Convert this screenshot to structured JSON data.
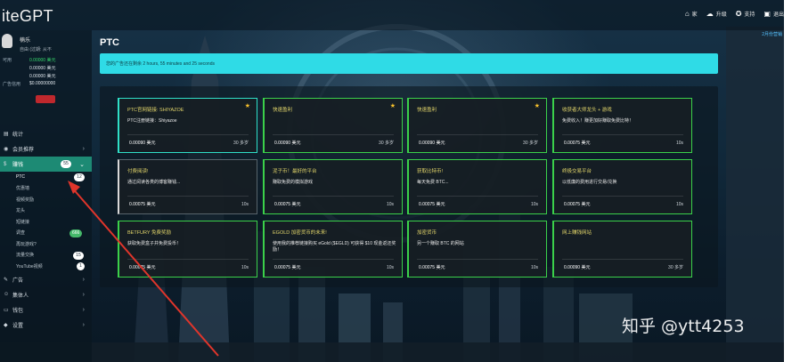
{
  "app": {
    "logo_text": "iteGPT"
  },
  "topnav": [
    {
      "icon": "home-icon",
      "glyph": "⌂",
      "label": "家"
    },
    {
      "icon": "cloud-upload-icon",
      "glyph": "☁",
      "label": "升级"
    },
    {
      "icon": "support-icon",
      "glyph": "✪",
      "label": "支持"
    },
    {
      "icon": "logout-icon",
      "glyph": "▣",
      "label": "退出"
    }
  ],
  "corner_link": "2月份营销",
  "user": {
    "name": "楠乐",
    "membership": "自由 (过期:  从不"
  },
  "balances": [
    {
      "key": "可用",
      "value": "0.00000 美元",
      "highlight": true
    },
    {
      "key": "",
      "value": "0.00000 美元",
      "highlight": false
    },
    {
      "key": "",
      "value": "0.00000 美元",
      "highlight": false
    },
    {
      "key": "广告信用",
      "value": "$0.00000000",
      "highlight": false
    }
  ],
  "sidebar_menu": [
    {
      "icon": "chart-icon",
      "glyph": "▤",
      "label": "统计"
    },
    {
      "icon": "users-icon",
      "glyph": "◉",
      "label": "会员推荐"
    },
    {
      "icon": "dollar-icon",
      "glyph": "$",
      "label": "赚钱",
      "badge": "55",
      "active": true
    }
  ],
  "earn_submenu": [
    {
      "label": "PTC",
      "badge": "12",
      "badge_color": "white",
      "selected": true
    },
    {
      "label": "优惠墙"
    },
    {
      "label": "视频奖励"
    },
    {
      "label": "龙头"
    },
    {
      "label": "短链接"
    },
    {
      "label": "调查",
      "badge": "666",
      "badge_color": "green"
    },
    {
      "label": "再玩游戏?"
    },
    {
      "label": "流量交换",
      "badge": "15",
      "badge_color": "white"
    },
    {
      "label": "YouTube视频",
      "badge": "1",
      "badge_color": "white"
    }
  ],
  "sidebar_menu_bottom": [
    {
      "icon": "megaphone-icon",
      "glyph": "✎",
      "label": "广告"
    },
    {
      "icon": "user-icon",
      "glyph": "☺",
      "label": "集体人"
    },
    {
      "icon": "wallet-icon",
      "glyph": "▭",
      "label": "钱包"
    },
    {
      "icon": "lock-icon",
      "glyph": "◆",
      "label": "设置"
    }
  ],
  "main": {
    "title": "PTC",
    "banner_text": "您的广告还在剩余 2 hours, 55 minutes and 25 seconds"
  },
  "ads": [
    {
      "title": "PTC官网链接:  SHIYAZOE",
      "desc": "PTC注册链接：Shiyazoe",
      "reward": "0.00090 美元",
      "time": "30 多岁",
      "star": true,
      "border": "teal"
    },
    {
      "title": "快速盈利",
      "desc": "",
      "reward": "0.00090 美元",
      "time": "30 多岁",
      "star": true,
      "border": "green"
    },
    {
      "title": "快速盈利",
      "desc": "",
      "reward": "0.00090 美元",
      "time": "30 多岁",
      "star": true,
      "border": "green"
    },
    {
      "title": "收获者大师龙头 + 游戏",
      "desc": "免费收入！赚更加好赚取免费比特！",
      "reward": "0.00075 美元",
      "time": "10s",
      "star": false,
      "border": "green"
    },
    {
      "title": "付费阅读!",
      "desc": "通过阅读各类的博客赚钱...",
      "reward": "0.00075 美元",
      "time": "10s",
      "star": false,
      "border": "plain"
    },
    {
      "title": "泥子币！最好的平台",
      "desc": "赚取免费的模拟游戏",
      "reward": "0.00075 美元",
      "time": "10s",
      "star": false,
      "border": "green"
    },
    {
      "title": "获取比特币!",
      "desc": "每天免费 BTC...",
      "reward": "0.00075 美元",
      "time": "10s",
      "star": false,
      "border": "green"
    },
    {
      "title": "终极交易平台",
      "desc": "以低廉的费用进行交易/兑换",
      "reward": "0.00075 美元",
      "time": "10s",
      "star": false,
      "border": "green"
    },
    {
      "title": "BETFURY 免费奖励",
      "desc": "获取免费盒子并免费投币！",
      "reward": "0.00075 美元",
      "time": "10s",
      "star": false,
      "border": "green"
    },
    {
      "title": "EGOLD 加密货币的未来!",
      "desc": "使用我的推荐链接购买 eGold ($EGLD) 可获得 $10 现金返还奖励！",
      "reward": "0.00075 美元",
      "time": "10s",
      "star": false,
      "border": "green"
    },
    {
      "title": "加密货币",
      "desc": "另一个赚取 BTC 的网站",
      "reward": "0.00075 美元",
      "time": "10s",
      "star": false,
      "border": "green"
    },
    {
      "title": "网上赚钱网站",
      "desc": "",
      "reward": "0.00090 美元",
      "time": "30 多岁",
      "star": false,
      "border": "green"
    }
  ],
  "watermark": "知乎 @ytt4253",
  "colors": {
    "accent_cyan": "#2fdbe6",
    "active_menu": "#1d8a74",
    "ad_title": "#e2d56a",
    "star": "#f6c02c",
    "annotation_arrow": "#e0352b"
  }
}
